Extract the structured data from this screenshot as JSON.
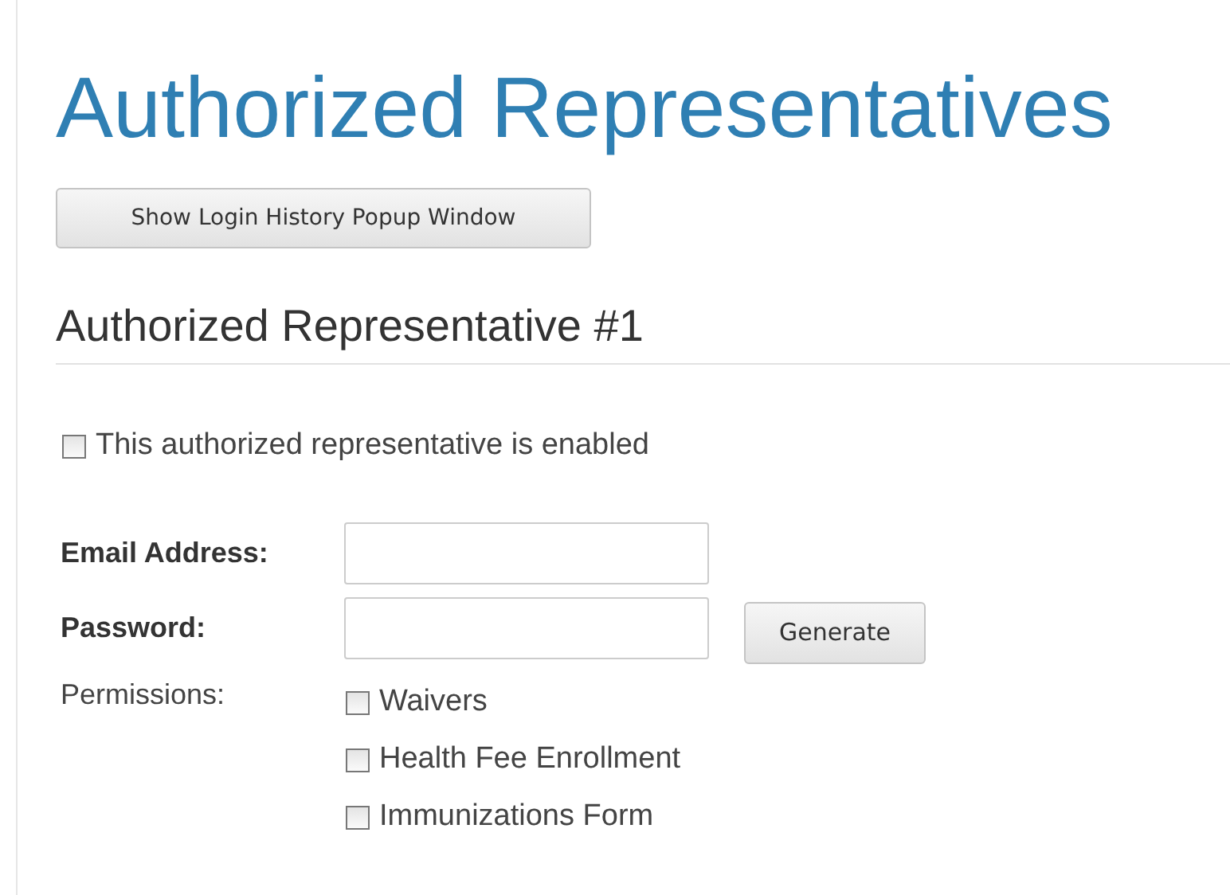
{
  "title": "Authorized Representatives",
  "history_button": "Show Login History Popup Window",
  "section_title": "Authorized Representative #1",
  "enabled": {
    "label": "This authorized representative is enabled",
    "checked": false
  },
  "fields": [
    {
      "label": "Email Address:"
    },
    {
      "label": "Password:",
      "button": "Generate"
    }
  ],
  "permissions": {
    "label": "Permissions:",
    "items": [
      {
        "label": "Waivers",
        "checked": false
      },
      {
        "label": "Health Fee Enrollment",
        "checked": false
      },
      {
        "label": "Immunizations Form",
        "checked": false
      }
    ]
  }
}
